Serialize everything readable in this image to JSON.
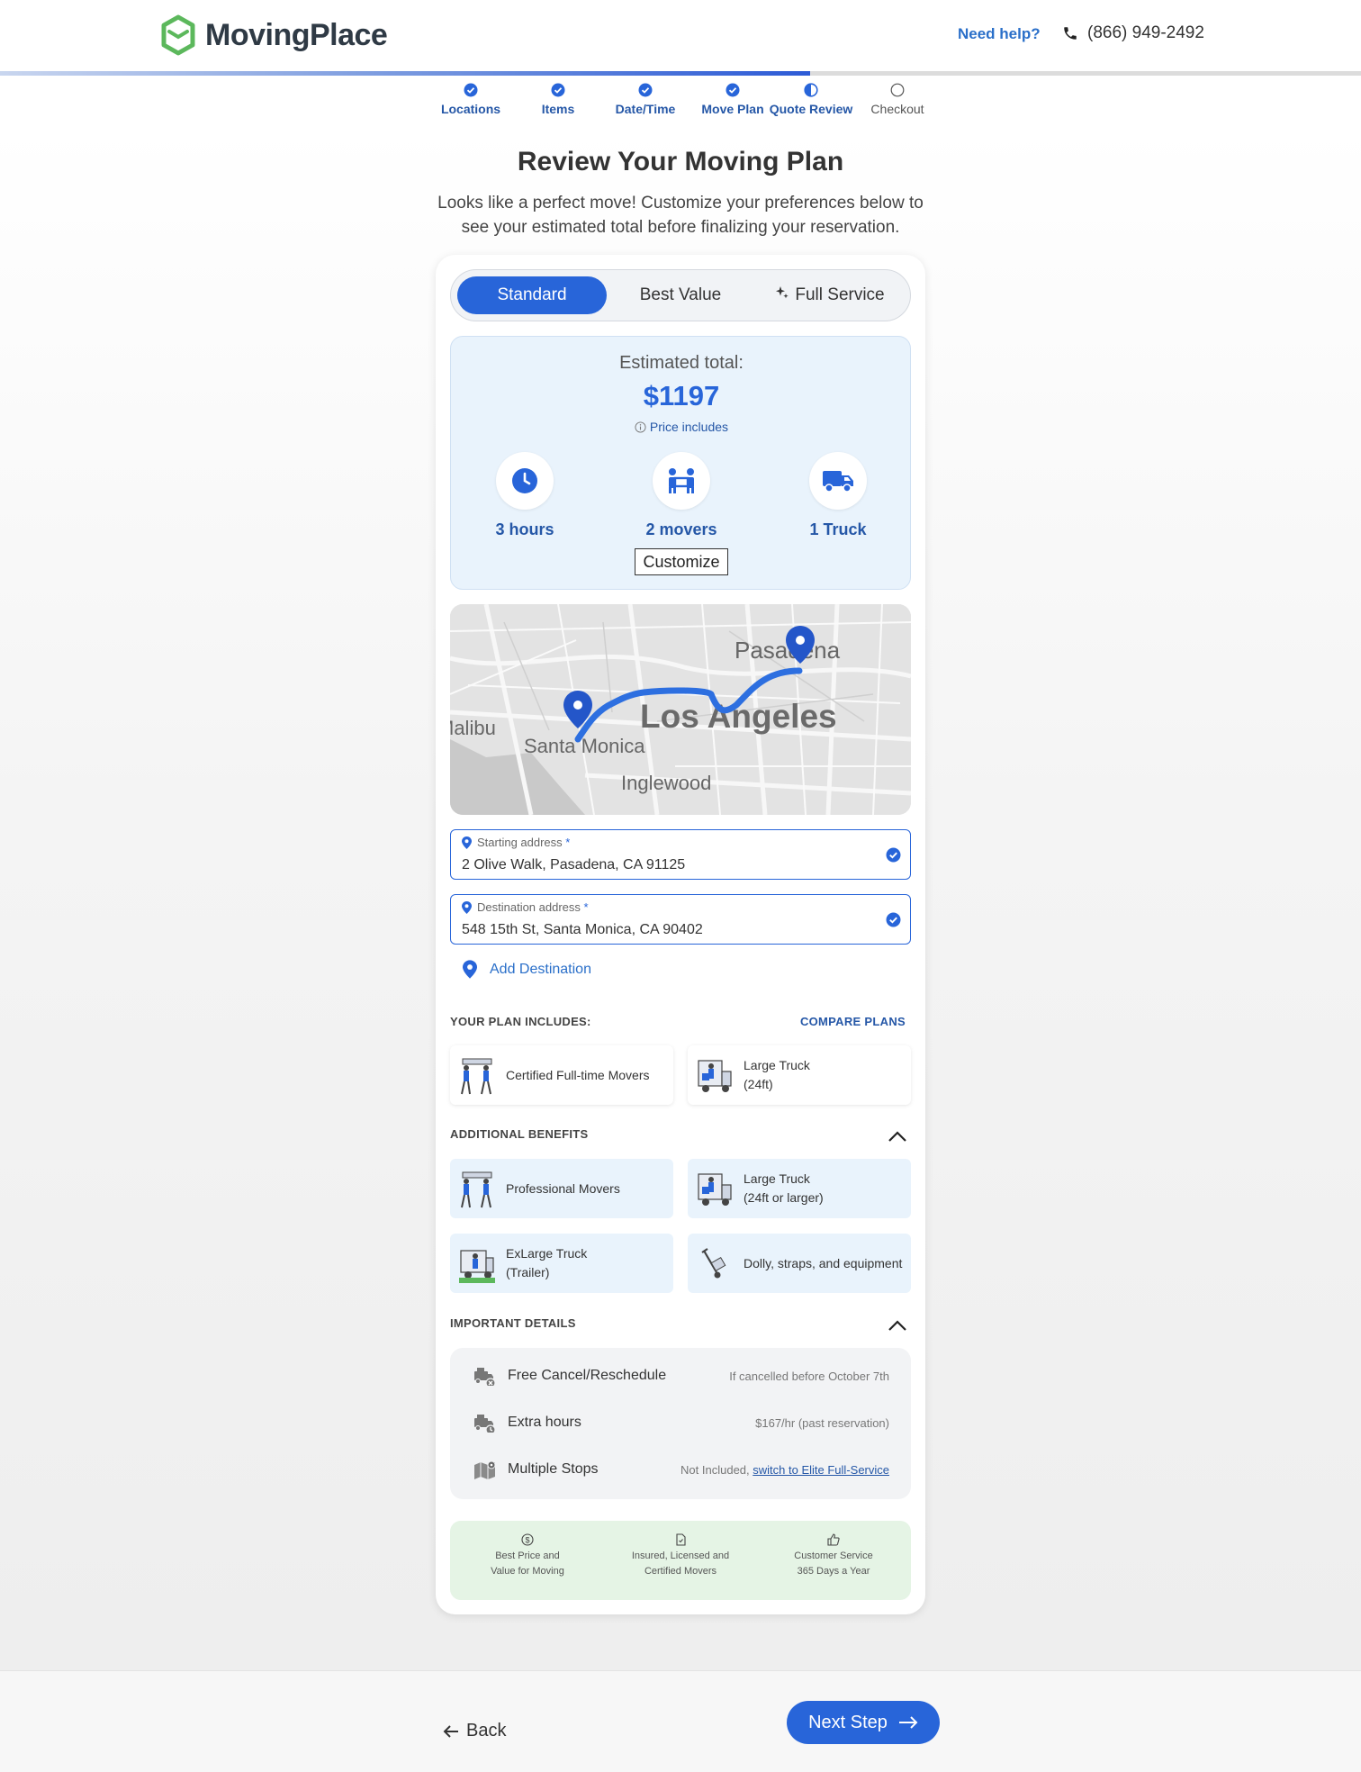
{
  "header": {
    "brand": "MovingPlace",
    "help": "Need help?",
    "phone": "(866) 949-2492"
  },
  "progress": {
    "fraction_complete": 0.6,
    "steps": [
      {
        "label": "Locations",
        "state": "done"
      },
      {
        "label": "Items",
        "state": "done"
      },
      {
        "label": "Date/Time",
        "state": "done"
      },
      {
        "label": "Move Plan",
        "state": "done"
      },
      {
        "label": "Quote Review",
        "state": "current"
      },
      {
        "label": "Checkout",
        "state": "todo"
      }
    ]
  },
  "page": {
    "title": "Review Your Moving Plan",
    "subtitle": "Looks like a perfect move! Customize your preferences below to see your estimated total before finalizing your reservation."
  },
  "plans": {
    "selected": "Standard",
    "tabs": [
      "Standard",
      "Best Value",
      "Full Service"
    ]
  },
  "estimate": {
    "label": "Estimated total:",
    "price": "$1197",
    "price_includes": "Price includes",
    "features": [
      "3 hours",
      "2 movers",
      "1 Truck"
    ],
    "customize": "Customize"
  },
  "map": {
    "labels": [
      "Pasadena",
      "Los Angeles",
      "Santa Monica",
      "Inglewood",
      "Malibu"
    ]
  },
  "addresses": {
    "start_label": "Starting address",
    "start_value": "2 Olive Walk, Pasadena, CA 91125",
    "dest_label": "Destination address",
    "dest_value": "548 15th St, Santa Monica, CA 90402",
    "required_mark": "*",
    "add_destination": "Add Destination"
  },
  "plan_includes": {
    "title": "YOUR PLAN INCLUDES:",
    "compare": "COMPARE PLANS",
    "items": [
      {
        "line1": "Certified Full-time Movers",
        "line2": ""
      },
      {
        "line1": "Large Truck",
        "line2": "(24ft)"
      }
    ]
  },
  "additional_benefits": {
    "title": "ADDITIONAL BENEFITS",
    "items": [
      {
        "line1": "Professional Movers",
        "line2": ""
      },
      {
        "line1": "Large Truck",
        "line2": "(24ft or larger)"
      },
      {
        "line1": "ExLarge Truck",
        "line2": "(Trailer)"
      },
      {
        "line1": "Dolly, straps, and equipment",
        "line2": ""
      }
    ]
  },
  "important_details": {
    "title": "IMPORTANT DETAILS",
    "rows": [
      {
        "name": "Free Cancel/Reschedule",
        "value": "If cancelled before October 7th",
        "link": ""
      },
      {
        "name": "Extra hours",
        "value": "$167/hr (past reservation)",
        "link": ""
      },
      {
        "name": "Multiple Stops",
        "value": "Not Included,",
        "link": "switch to Elite Full-Service"
      }
    ]
  },
  "trust": [
    {
      "line1": "Best Price and",
      "line2": "Value for Moving",
      "icon": "dollar-icon"
    },
    {
      "line1": "Insured, Licensed and",
      "line2": "Certified Movers",
      "icon": "document-icon"
    },
    {
      "line1": "Customer Service",
      "line2": "365 Days a Year",
      "icon": "thumbs-up-icon"
    }
  ],
  "footer": {
    "back": "Back",
    "next": "Next Step"
  },
  "colors": {
    "accent": "#2865d9",
    "accent_text": "#2557a7",
    "brand_green": "#5cb85c",
    "estimate_bg": "#e9f3fc",
    "trust_bg": "#e5f4e5"
  }
}
